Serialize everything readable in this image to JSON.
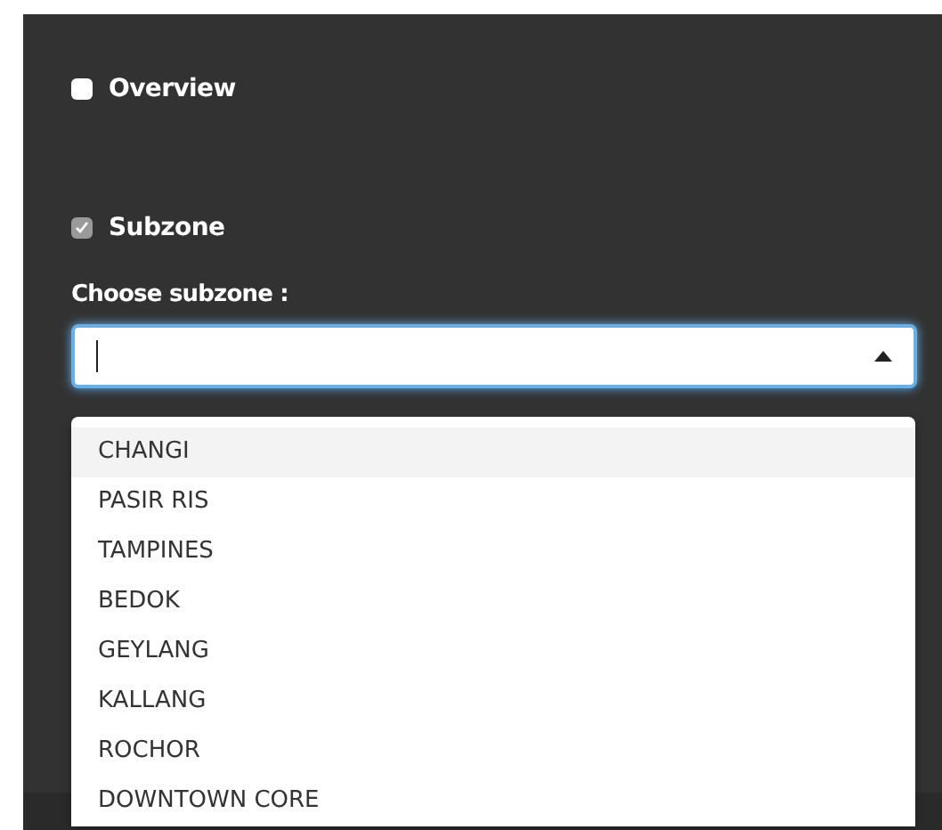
{
  "options": [
    {
      "label": "Overview",
      "checked": false
    },
    {
      "label": "Subzone",
      "checked": true
    }
  ],
  "select": {
    "label": "Choose subzone :",
    "open": true
  },
  "dropdown": [
    {
      "label": "CHANGI",
      "selected": true
    },
    {
      "label": "PASIR RIS",
      "selected": false
    },
    {
      "label": "TAMPINES",
      "selected": false
    },
    {
      "label": "BEDOK",
      "selected": false
    },
    {
      "label": "GEYLANG",
      "selected": false
    },
    {
      "label": "KALLANG",
      "selected": false
    },
    {
      "label": "ROCHOR",
      "selected": false
    },
    {
      "label": "DOWNTOWN CORE",
      "selected": false
    }
  ]
}
